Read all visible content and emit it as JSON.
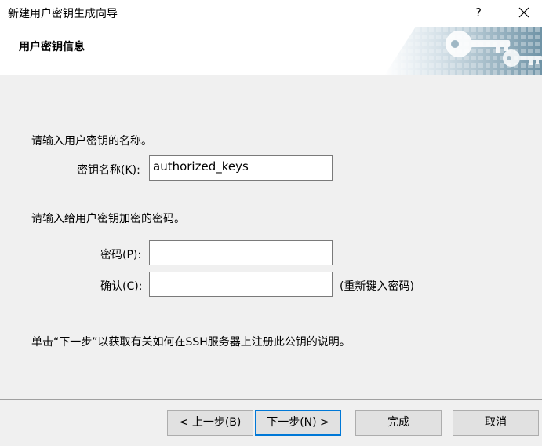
{
  "window": {
    "title": "新建用户密钥生成向导",
    "help_label": "?"
  },
  "header": {
    "title": "用户密钥信息"
  },
  "key_name": {
    "prompt": "请输入用户密钥的名称。",
    "label": "密钥名称(K):",
    "value": "authorized_keys"
  },
  "password": {
    "prompt": "请输入给用户密钥加密的密码。",
    "password_label": "密码(P):",
    "password_value": "",
    "confirm_label": "确认(C):",
    "confirm_value": "",
    "confirm_hint": "(重新键入密码)"
  },
  "info_text": "单击“下一步”以获取有关如何在SSH服务器上注册此公钥的说明。",
  "buttons": {
    "back": "< 上一步(B)",
    "next": "下一步(N) >",
    "finish": "完成",
    "cancel": "取消"
  },
  "colors": {
    "accent": "#0078d7",
    "background": "#f0f0f0"
  }
}
